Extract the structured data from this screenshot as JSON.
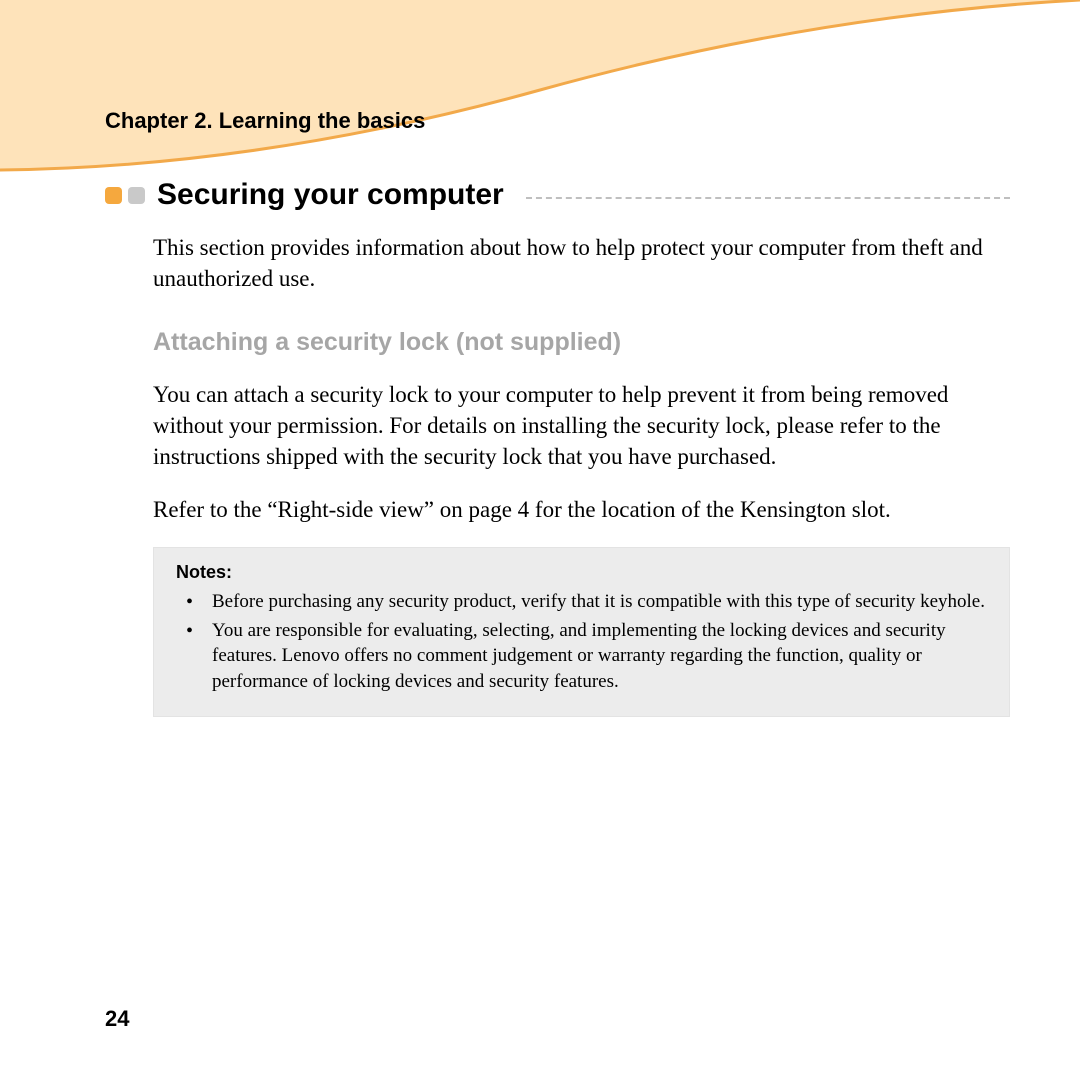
{
  "chapter_label": "Chapter 2. Learning the basics",
  "section_title": "Securing your computer",
  "intro": "This section provides information about how to help protect your computer from theft and unauthorized use.",
  "subheading": "Attaching a security lock (not supplied)",
  "body_p1": "You can attach a security lock to your computer to help prevent it from being removed without your permission. For details on installing the security lock, please refer to the instructions shipped with the security lock that you have purchased.",
  "body_p2": "Refer to the “Right-side view” on page 4 for the location of the Kensington slot.",
  "notes_label": "Notes:",
  "notes": [
    "Before purchasing any security product, verify that it is compatible with this type of security keyhole.",
    "You are responsible for evaluating, selecting, and implementing the locking devices and security features. Lenovo offers no comment judgement or warranty regarding the function, quality or performance of locking devices and security features."
  ],
  "page_number": "24"
}
